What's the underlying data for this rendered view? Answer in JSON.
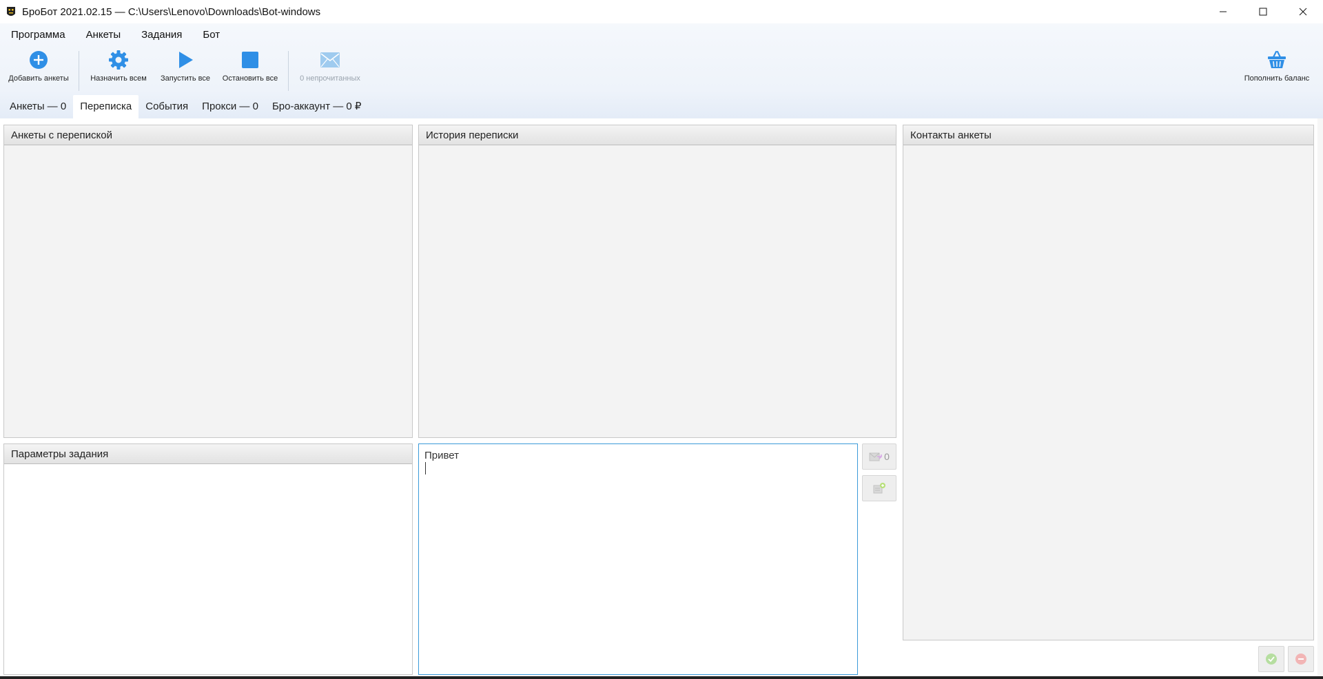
{
  "window": {
    "title": "БроБот 2021.02.15 — C:\\Users\\Lenovo\\Downloads\\Bot-windows"
  },
  "menu": [
    "Программа",
    "Анкеты",
    "Задания",
    "Бот"
  ],
  "toolbar": {
    "add_profiles": "Добавить анкеты",
    "assign_all": "Назначить всем",
    "start_all": "Запустить все",
    "stop_all": "Остановить все",
    "unread": "0 непрочитанных",
    "top_up": "Пополнить баланс"
  },
  "tabs": [
    "Анкеты — 0",
    "Переписка",
    "События",
    "Прокси — 0",
    "Бро-аккаунт — 0 ₽"
  ],
  "active_tab": "Переписка",
  "panels": {
    "profiles_with_chat": "Анкеты с перепиской",
    "chat_history": "История переписки",
    "profile_contacts": "Контакты анкеты",
    "task_params": "Параметры задания"
  },
  "message_editor": {
    "value": "Привет"
  },
  "send_count": "0",
  "colors": {
    "accent": "#2f8fe6",
    "editor_border": "#3a9ad9",
    "disabled_icon": "#9fcbef"
  }
}
